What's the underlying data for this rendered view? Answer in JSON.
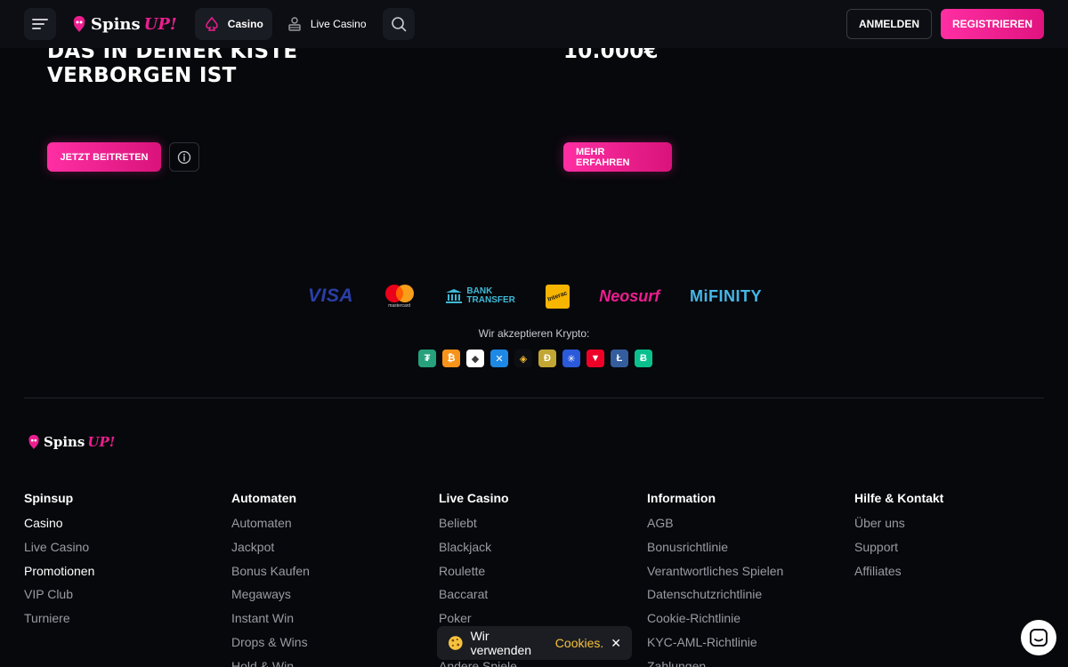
{
  "header": {
    "logo_text": "Spins",
    "logo_accent": "UP!",
    "tab_casino": "Casino",
    "tab_live_casino": "Live Casino",
    "login_label": "ANMELDEN",
    "register_label": "REGISTRIEREN"
  },
  "hero": {
    "left_line1": "DAS IN DEINER KISTE",
    "left_line2": "VERBORGEN IST",
    "right_line1": "10.000€",
    "join_label": "JETZT BEITRETEN",
    "more_label": "MEHR ERFAHREN"
  },
  "payments": {
    "visa": "VISA",
    "mastercard": "mastercard",
    "bank_line1": "BANK",
    "bank_line2": "TRANSFER",
    "interac": "Interac",
    "neosurf": "Neosurf",
    "mifinity": "MiFINITY",
    "crypto_label": "Wir akzeptieren Krypto:",
    "cryptos": [
      {
        "glyph": "₮",
        "color": "#26a17b"
      },
      {
        "glyph": "₿",
        "color": "#f7931a"
      },
      {
        "glyph": "◆",
        "color": "#ffffff"
      },
      {
        "glyph": "✕",
        "color": "#1e88e5"
      },
      {
        "glyph": "◈",
        "color": "#f3ba2f"
      },
      {
        "glyph": "Ð",
        "color": "#c2a633"
      },
      {
        "glyph": "✳",
        "color": "#2a5ada"
      },
      {
        "glyph": "▼",
        "color": "#ef0027"
      },
      {
        "glyph": "Ł",
        "color": "#345d9d"
      },
      {
        "glyph": "Ƀ",
        "color": "#0ac18e"
      }
    ]
  },
  "footer": {
    "logo_text": "Spins",
    "logo_accent": "UP!",
    "columns": [
      {
        "title": "Spinsup",
        "items": [
          "Casino",
          "Live Casino",
          "Promotionen",
          "VIP Club",
          "Turniere"
        ]
      },
      {
        "title": "Automaten",
        "items": [
          "Automaten",
          "Jackpot",
          "Bonus Kaufen",
          "Megaways",
          "Instant Win",
          "Drops & Wins",
          "Hold & Win"
        ]
      },
      {
        "title": "Live Casino",
        "items": [
          "Beliebt",
          "Blackjack",
          "Roulette",
          "Baccarat",
          "Poker",
          "",
          "Andere Spiele"
        ]
      },
      {
        "title": "Information",
        "items": [
          "AGB",
          "Bonusrichtlinie",
          "Verantwortliches Spielen",
          "Datenschutzrichtlinie",
          "Cookie-Richtlinie",
          "KYC-AML-Richtlinie",
          "Zahlungen"
        ]
      },
      {
        "title": "Hilfe & Kontakt",
        "items": [
          "Über uns",
          "Support",
          "Affiliates"
        ]
      }
    ]
  },
  "cookie": {
    "text": "Wir verwenden",
    "link": "Cookies."
  },
  "colors": {
    "accent": "#ec1e8f",
    "background": "#07080c",
    "cookie_link": "#f6c23d"
  }
}
